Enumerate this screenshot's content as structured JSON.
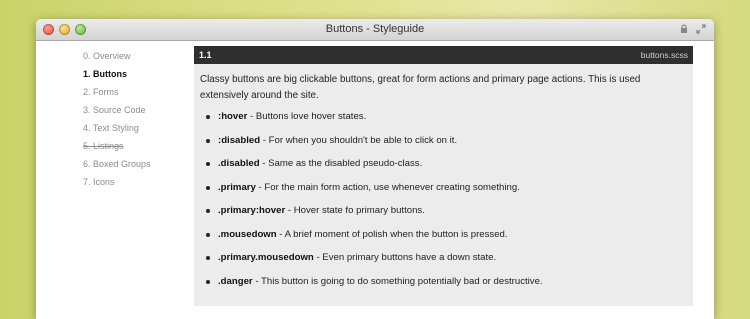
{
  "window": {
    "title": "Buttons - Styleguide"
  },
  "icons": {
    "close": "close-traffic-light",
    "minimize": "minimize-traffic-light",
    "maximize": "zoom-traffic-light",
    "lock": "lock-icon",
    "fullscreen": "fullscreen-icon"
  },
  "sidebar": {
    "items": [
      {
        "label": "0. Overview"
      },
      {
        "label": "1. Buttons"
      },
      {
        "label": "2. Forms"
      },
      {
        "label": "3. Source Code"
      },
      {
        "label": "4. Text Styling"
      },
      {
        "label": "5. Listings"
      },
      {
        "label": "6. Boxed Groups"
      },
      {
        "label": "7. Icons"
      }
    ]
  },
  "main": {
    "section_number": "1.1",
    "filename": "buttons.scss",
    "intro": "Classy buttons are big clickable buttons, great for form actions and primary page actions. This is used extensively around the site.",
    "items": [
      {
        "code": ":hover",
        "desc": " - Buttons love hover states."
      },
      {
        "code": ":disabled",
        "desc": " - For when you shouldn't be able to click on it."
      },
      {
        "code": ".disabled",
        "desc": " - Same as the disabled pseudo-class."
      },
      {
        "code": ".primary",
        "desc": " - For the main form action, use whenever creating something."
      },
      {
        "code": ".primary:hover",
        "desc": " - Hover state fo primary buttons."
      },
      {
        "code": ".mousedown",
        "desc": " - A brief moment of polish when the button is pressed."
      },
      {
        "code": ".primary.mousedown",
        "desc": " - Even primary buttons have a down state."
      },
      {
        "code": ".danger",
        "desc": " - This button is going to do something potentially bad or destructive."
      }
    ]
  },
  "colors": {
    "header_bar": "#2f2f2f",
    "main_bg": "#ececec",
    "inactive_nav": "#8c8c8c"
  }
}
